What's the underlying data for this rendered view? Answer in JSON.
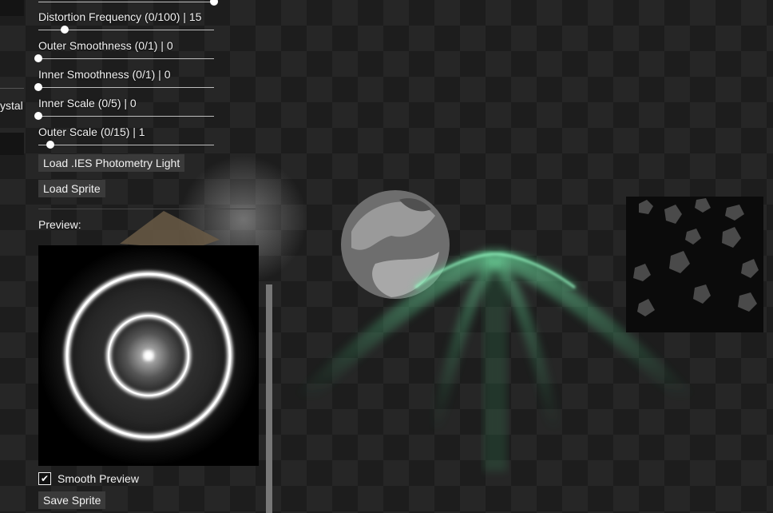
{
  "left_panel": {
    "partial_label": "ystal"
  },
  "sliders": [
    {
      "label": "Distortion Frequency  (0/100) | 15",
      "value": 15,
      "min": 0,
      "max": 100
    },
    {
      "label": "Outer Smoothness  (0/1) | 0",
      "value": 0,
      "min": 0,
      "max": 1
    },
    {
      "label": "Inner Smoothness  (0/1) | 0",
      "value": 0,
      "min": 0,
      "max": 1
    },
    {
      "label": "Inner Scale  (0/5) | 0",
      "value": 0,
      "min": 0,
      "max": 5
    },
    {
      "label": "Outer Scale  (0/15) | 1",
      "value": 1,
      "min": 0,
      "max": 15
    }
  ],
  "buttons": {
    "load_ies": "Load .IES Photometry Light",
    "load_sprite": "Load Sprite",
    "save_sprite": "Save Sprite"
  },
  "preview": {
    "label": "Preview:",
    "smooth_label": "Smooth Preview",
    "smooth_checked": true
  },
  "colors": {
    "beam": "#4fd98a",
    "panel_button": "#3a3a3a"
  }
}
